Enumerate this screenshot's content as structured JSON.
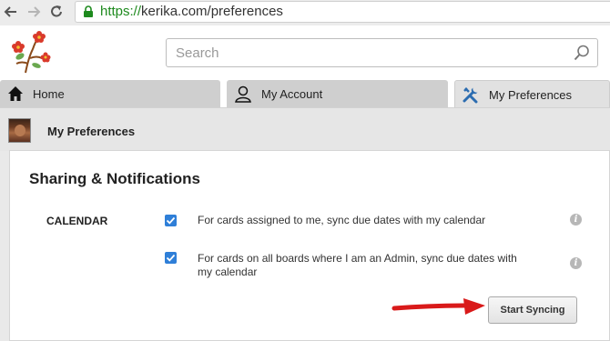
{
  "browser": {
    "url_secure": "https://",
    "url_rest": "kerika.com/preferences",
    "secure_color": "#1e8a1e"
  },
  "header": {
    "search_placeholder": "Search",
    "logo_icon": "kerika-flower-logo"
  },
  "tabs": [
    {
      "label": "Home",
      "icon": "home-icon",
      "active": false
    },
    {
      "label": "My Account",
      "icon": "user-icon",
      "active": false
    },
    {
      "label": "My Preferences",
      "icon": "tools-icon",
      "active": true
    }
  ],
  "prefbar": {
    "title": "My Preferences"
  },
  "panel": {
    "section_title": "Sharing & Notifications",
    "calendar_label": "CALENDAR",
    "options": [
      {
        "text": "For cards assigned to me, sync due dates with my calendar",
        "checked": true
      },
      {
        "text": "For cards on all boards where I am an Admin, sync due dates with my calendar",
        "checked": true
      }
    ],
    "info_glyph": "i",
    "sync_button": "Start Syncing",
    "accent_color": "#2f7fd8",
    "arrow_color": "#d91a1a"
  }
}
